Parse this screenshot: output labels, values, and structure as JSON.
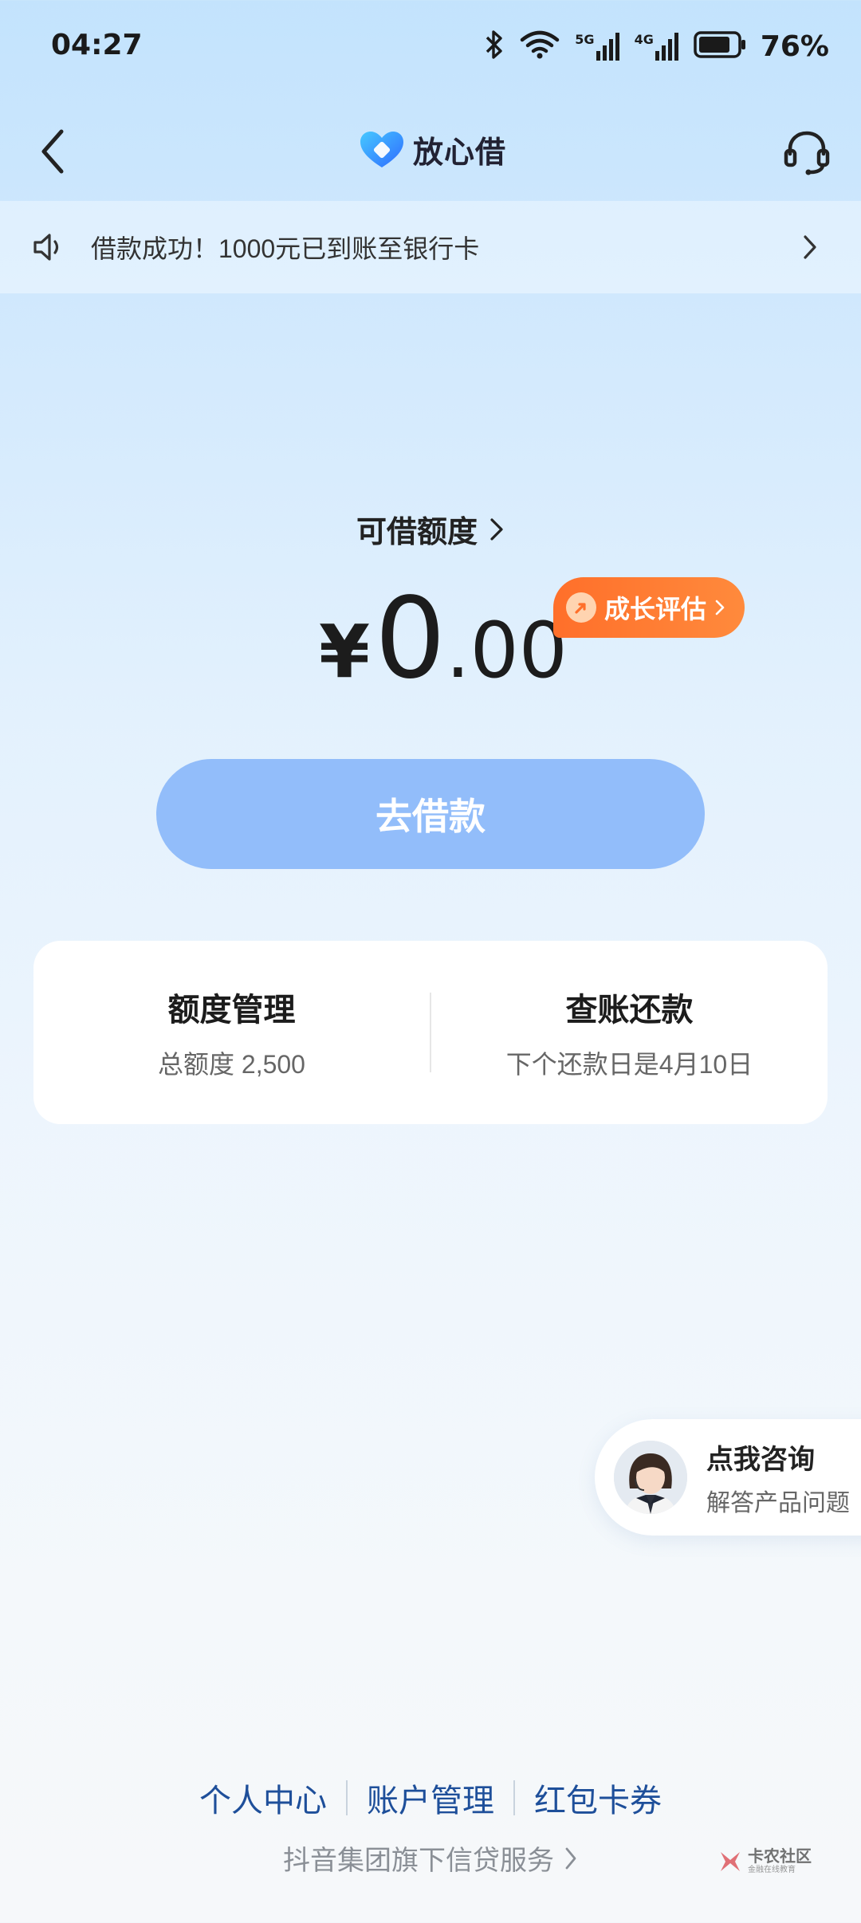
{
  "status_bar": {
    "time": "04:27",
    "network_5g": "5G",
    "network_4g": "4G",
    "battery": "76%"
  },
  "header": {
    "title": "放心借",
    "back_icon": "chevron-left-icon",
    "service_icon": "headset-icon"
  },
  "notice": {
    "text": "借款成功！1000元已到账至银行卡"
  },
  "credit": {
    "label": "可借额度",
    "currency": "¥",
    "amount_int": "0",
    "amount_dec": ".00",
    "growth_badge": "成长评估"
  },
  "borrow_button": {
    "label": "去借款"
  },
  "summary_card": {
    "limit_title": "额度管理",
    "limit_sub": "总额度 2,500",
    "bill_title": "查账还款",
    "bill_sub": "下个还款日是4月10日"
  },
  "consult": {
    "title": "点我咨询",
    "subtitle": "解答产品问题"
  },
  "footer": {
    "links": [
      "个人中心",
      "账户管理",
      "红包卡券"
    ],
    "note": "抖音集团旗下信贷服务"
  },
  "watermark": {
    "main": "卡农社区",
    "sub": "金融在线教育"
  },
  "colors": {
    "accent": "#92bdfa",
    "badge": "#ff7a2f",
    "link": "#1e4f9a"
  }
}
